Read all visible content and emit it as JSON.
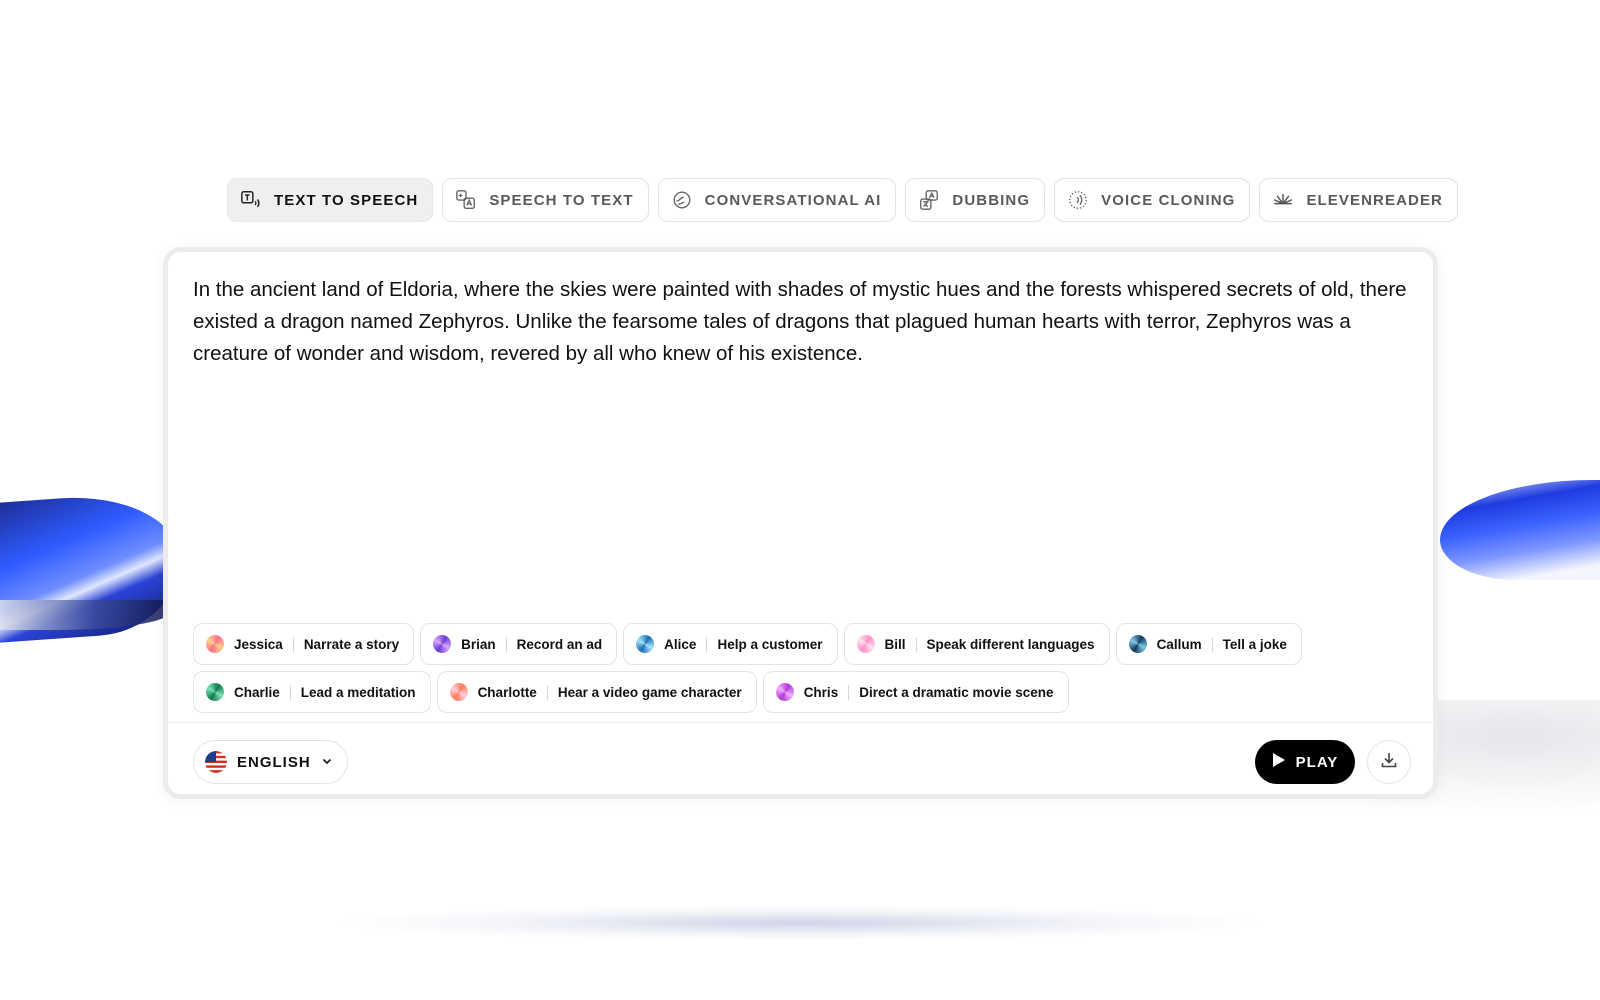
{
  "tabs": [
    {
      "label": "TEXT TO SPEECH",
      "icon": "text-to-speech-icon",
      "active": true
    },
    {
      "label": "SPEECH TO TEXT",
      "icon": "speech-to-text-icon",
      "active": false
    },
    {
      "label": "CONVERSATIONAL AI",
      "icon": "conversational-ai-icon",
      "active": false
    },
    {
      "label": "DUBBING",
      "icon": "dubbing-icon",
      "active": false
    },
    {
      "label": "VOICE CLONING",
      "icon": "voice-cloning-icon",
      "active": false
    },
    {
      "label": "ELEVENREADER",
      "icon": "elevenreader-icon",
      "active": false
    }
  ],
  "editor": {
    "text": "In the ancient land of Eldoria, where the skies were painted with shades of mystic hues and the forests whispered secrets of old, there existed a dragon named Zephyros. Unlike the fearsome tales of dragons that plagued human hearts with terror, Zephyros was a creature of wonder and wisdom, revered by all who knew of his existence."
  },
  "voices_row1": [
    {
      "name": "Jessica",
      "task": "Narrate a story",
      "color_a": "#ff6f8f",
      "color_b": "#ffd08a"
    },
    {
      "name": "Brian",
      "task": "Record an ad",
      "color_a": "#6a3fd6",
      "color_b": "#d9a6ff"
    },
    {
      "name": "Alice",
      "task": "Help a customer",
      "color_a": "#1a6fb0",
      "color_b": "#a8e3ff"
    },
    {
      "name": "Bill",
      "task": "Speak different languages",
      "color_a": "#ff8fc7",
      "color_b": "#ffe0f0"
    },
    {
      "name": "Callum",
      "task": "Tell a joke",
      "color_a": "#123a5c",
      "color_b": "#7fc7e6"
    }
  ],
  "voices_row2": [
    {
      "name": "Charlie",
      "task": "Lead a meditation",
      "color_a": "#0f7a4a",
      "color_b": "#7fe3b8"
    },
    {
      "name": "Charlotte",
      "task": "Hear a video game character",
      "color_a": "#ff7a59",
      "color_b": "#ffd0e0"
    },
    {
      "name": "Chris",
      "task": "Direct a dramatic movie scene",
      "color_a": "#b23ad6",
      "color_b": "#f0b0ff"
    }
  ],
  "language": {
    "label": "ENGLISH",
    "flag": "us-flag-icon"
  },
  "actions": {
    "play_label": "PLAY",
    "download_icon": "download-icon"
  }
}
